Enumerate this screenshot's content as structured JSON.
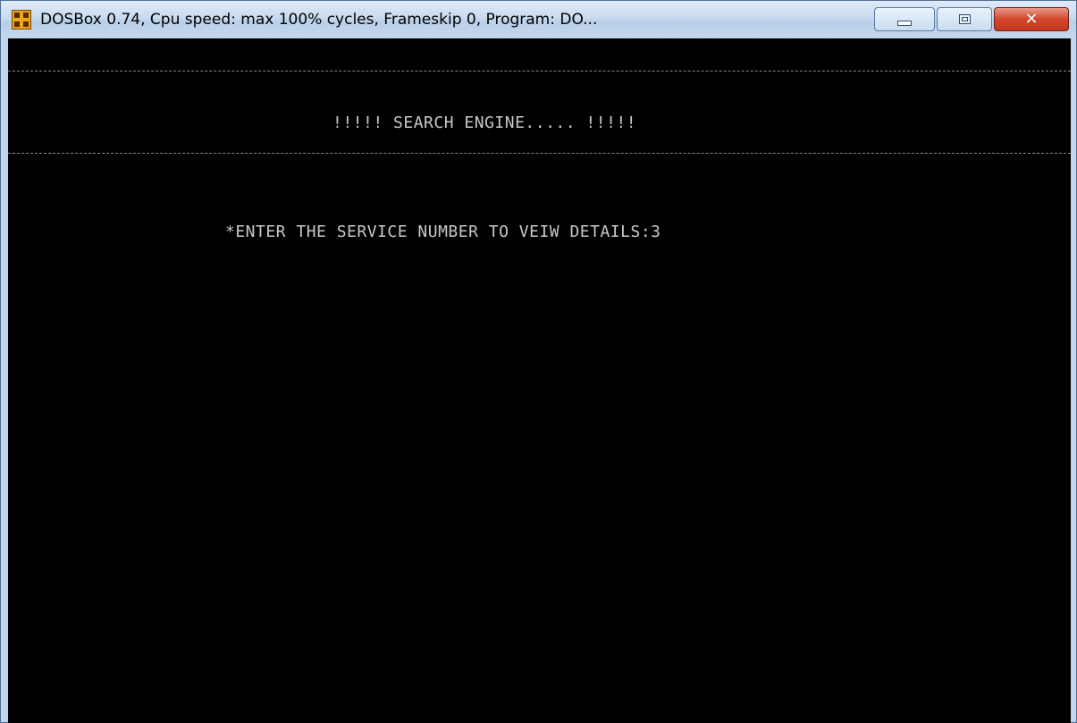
{
  "window": {
    "title": "DOSBox 0.74, Cpu speed: max 100% cycles, Frameskip  0, Program:   DO...",
    "icon": "dosbox-icon",
    "controls": {
      "minimize": "minimize-icon",
      "maximize": "maximize-icon",
      "close": "close-icon"
    }
  },
  "console": {
    "heading": "!!!!! SEARCH ENGINE..... !!!!!",
    "prompt": "*ENTER THE SERVICE NUMBER TO VEIW DETAILS:3"
  },
  "colors": {
    "console_bg": "#000000",
    "console_text": "#c8c8c8",
    "close_button": "#d2462c",
    "titlebar": "#c9dbef"
  }
}
